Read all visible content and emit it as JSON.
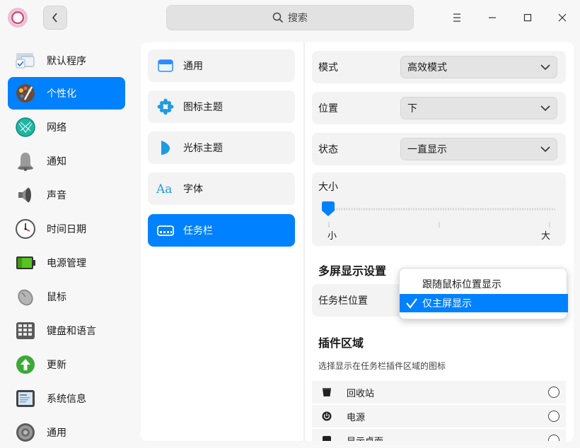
{
  "titlebar": {
    "search_placeholder": "搜索"
  },
  "sidebar": {
    "items": [
      {
        "label": "默认程序",
        "icon": "default-apps-icon",
        "active": false
      },
      {
        "label": "个性化",
        "icon": "personalization-icon",
        "active": true
      },
      {
        "label": "网络",
        "icon": "network-icon",
        "active": false
      },
      {
        "label": "通知",
        "icon": "bell-icon",
        "active": false
      },
      {
        "label": "声音",
        "icon": "speaker-icon",
        "active": false
      },
      {
        "label": "时间日期",
        "icon": "clock-icon",
        "active": false
      },
      {
        "label": "电源管理",
        "icon": "battery-icon",
        "active": false
      },
      {
        "label": "鼠标",
        "icon": "mouse-icon",
        "active": false
      },
      {
        "label": "键盘和语言",
        "icon": "keyboard-icon",
        "active": false
      },
      {
        "label": "更新",
        "icon": "update-icon",
        "active": false
      },
      {
        "label": "系统信息",
        "icon": "system-info-icon",
        "active": false
      },
      {
        "label": "通用",
        "icon": "general-gear-icon",
        "active": false
      }
    ]
  },
  "subnav": {
    "items": [
      {
        "label": "通用",
        "icon": "window-icon",
        "active": false
      },
      {
        "label": "图标主题",
        "icon": "flower-icon",
        "active": false
      },
      {
        "label": "光标主题",
        "icon": "cursor-icon",
        "active": false
      },
      {
        "label": "字体",
        "icon": "font-icon",
        "active": false
      },
      {
        "label": "任务栏",
        "icon": "taskbar-icon",
        "active": true
      }
    ]
  },
  "settings": {
    "mode": {
      "label": "模式",
      "value": "高效模式"
    },
    "position": {
      "label": "位置",
      "value": "下"
    },
    "state": {
      "label": "状态",
      "value": "一直显示"
    },
    "size": {
      "label": "大小",
      "min_label": "小",
      "max_label": "大",
      "value_fraction": 0.0
    },
    "multi_screen_heading": "多屏显示设置",
    "taskbar_position_label": "任务栏位置",
    "plugin_heading": "插件区域",
    "plugin_desc": "选择显示在任务栏插件区域的图标",
    "plugins": [
      {
        "label": "回收站",
        "icon": "trash-icon"
      },
      {
        "label": "电源",
        "icon": "power-icon"
      },
      {
        "label": "显示桌面",
        "icon": "desktop-icon"
      }
    ]
  },
  "popup": {
    "options": [
      {
        "label": "跟随鼠标位置显示",
        "selected": false
      },
      {
        "label": "仅主屏显示",
        "selected": true
      }
    ]
  },
  "colors": {
    "accent": "#0081ff"
  }
}
